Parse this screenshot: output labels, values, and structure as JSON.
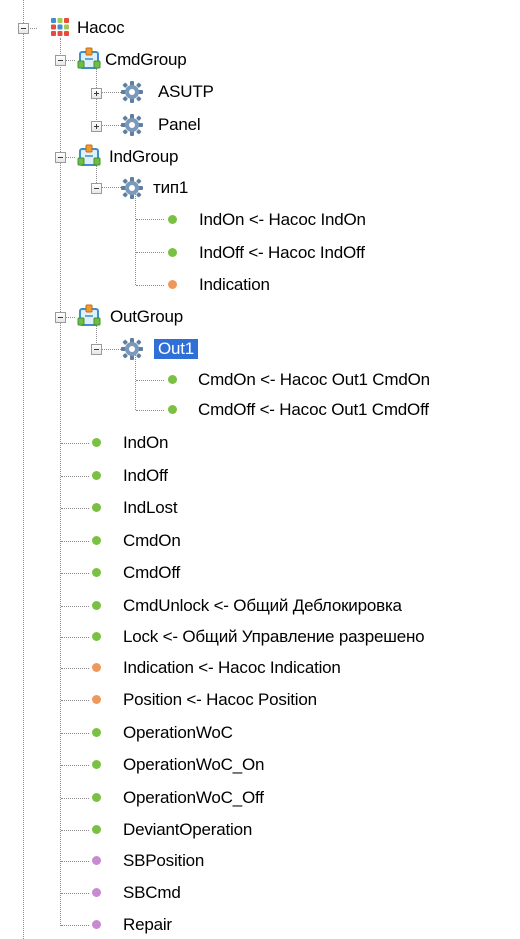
{
  "colors": {
    "green": "#7ac143",
    "orange": "#f0985a",
    "purple": "#c78bd0",
    "selection": "#2f6fd6"
  },
  "tree": {
    "root": {
      "label": "Насос",
      "icon": "grid-icon",
      "expanded": true
    },
    "groups": [
      {
        "label": "CmdGroup",
        "icon": "group-icon",
        "expanded": true,
        "children": [
          {
            "label": "ASUTP",
            "icon": "gear-icon",
            "expanded": false
          },
          {
            "label": "Panel",
            "icon": "gear-icon",
            "expanded": false
          }
        ]
      },
      {
        "label": "IndGroup",
        "icon": "group-icon",
        "expanded": true,
        "children": [
          {
            "label": "тип1",
            "icon": "gear-icon",
            "expanded": true,
            "children": [
              {
                "label": "IndOn <- Насос IndOn",
                "dot": "green"
              },
              {
                "label": "IndOff <- Насос IndOff",
                "dot": "green"
              },
              {
                "label": "Indication",
                "dot": "orange"
              }
            ]
          }
        ]
      },
      {
        "label": "OutGroup",
        "icon": "group-icon",
        "expanded": true,
        "children": [
          {
            "label": "Out1",
            "icon": "gear-icon",
            "expanded": true,
            "selected": true,
            "children": [
              {
                "label": "CmdOn <- Насос Out1 CmdOn",
                "dot": "green"
              },
              {
                "label": "CmdOff <- Насос Out1 CmdOff",
                "dot": "green"
              }
            ]
          }
        ]
      }
    ],
    "leaves": [
      {
        "label": "IndOn",
        "dot": "green"
      },
      {
        "label": "IndOff",
        "dot": "green"
      },
      {
        "label": "IndLost",
        "dot": "green"
      },
      {
        "label": "CmdOn",
        "dot": "green"
      },
      {
        "label": "CmdOff",
        "dot": "green"
      },
      {
        "label": "CmdUnlock <- Общий Деблокировка",
        "dot": "green"
      },
      {
        "label": "Lock <- Общий Управление разрешено",
        "dot": "green"
      },
      {
        "label": "Indication <- Насос Indication",
        "dot": "orange"
      },
      {
        "label": "Position <- Насос Position",
        "dot": "orange"
      },
      {
        "label": "OperationWoC",
        "dot": "green"
      },
      {
        "label": "OperationWoC_On",
        "dot": "green"
      },
      {
        "label": "OperationWoC_Off",
        "dot": "green"
      },
      {
        "label": "DeviantOperation",
        "dot": "green"
      },
      {
        "label": "SBPosition",
        "dot": "purple"
      },
      {
        "label": "SBCmd",
        "dot": "purple"
      },
      {
        "label": "Repair",
        "dot": "purple"
      }
    ]
  }
}
